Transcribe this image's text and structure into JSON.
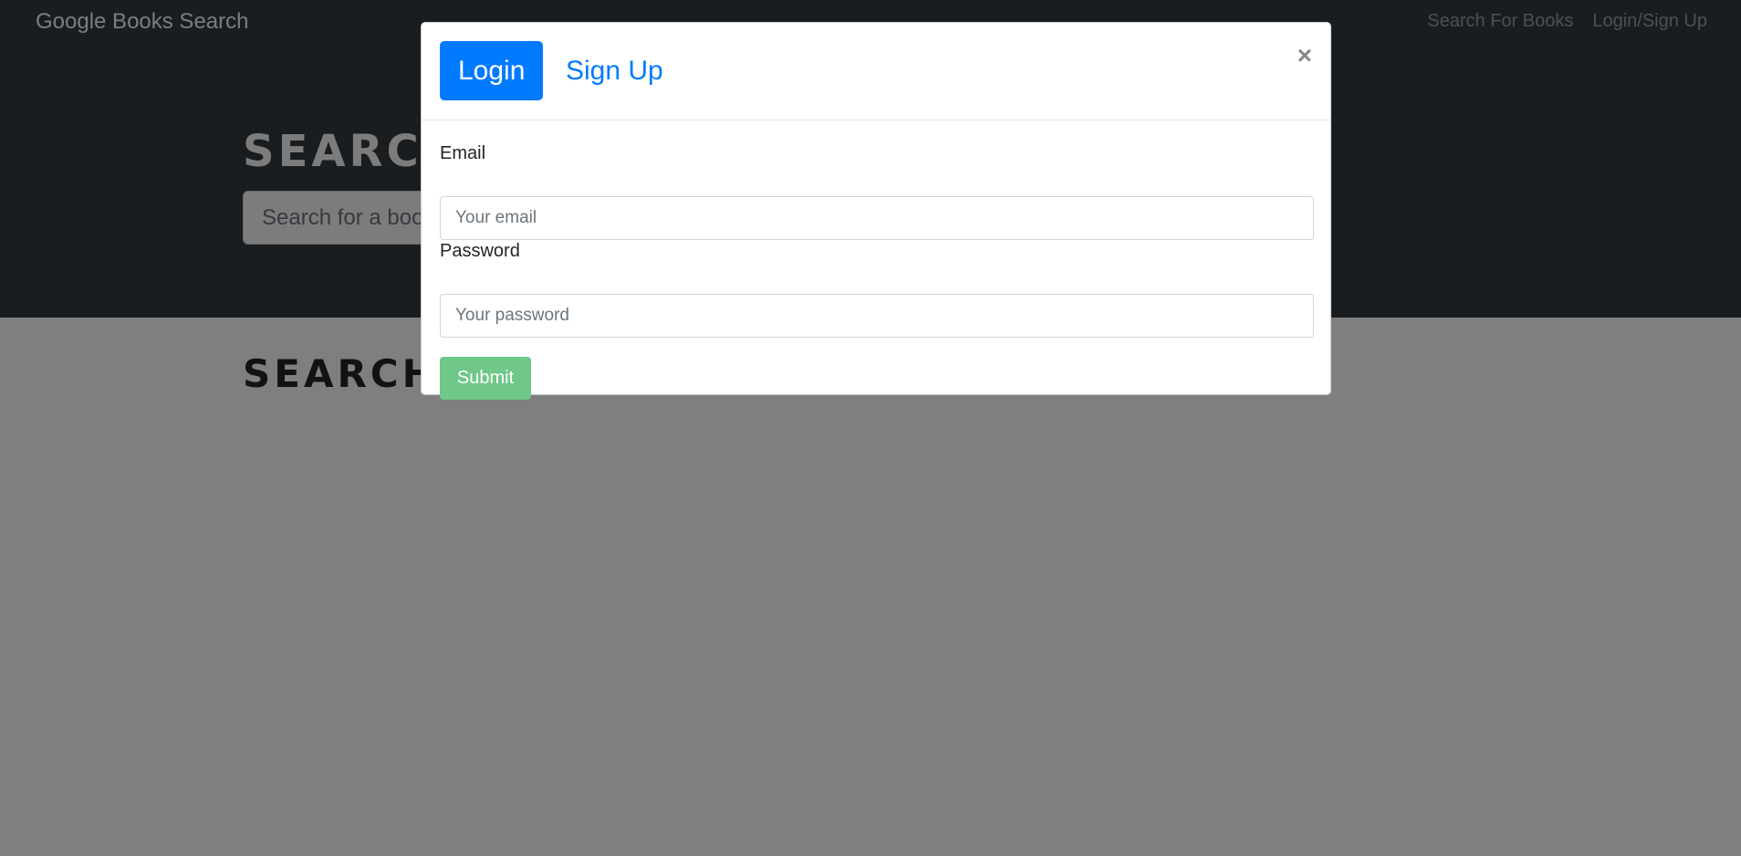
{
  "navbar": {
    "brand": "Google Books Search",
    "links": [
      "Search For Books",
      "Login/Sign Up"
    ]
  },
  "hero": {
    "title": "SEARCH FOR BOOKS!",
    "search_placeholder": "Search for a book"
  },
  "results": {
    "heading": "SEARCH FOR A BOOK TO BEGIN"
  },
  "modal": {
    "tabs": [
      "Login",
      "Sign Up"
    ],
    "active_tab": "Login",
    "close_symbol": "×",
    "email_label": "Email",
    "email_placeholder": "Your email",
    "password_label": "Password",
    "password_placeholder": "Your password",
    "submit_label": "Submit"
  },
  "colors": {
    "navbar_bg": "#343a40",
    "primary": "#007bff",
    "submit_disabled": "#6fc788",
    "backdrop": "rgba(0,0,0,0.5)"
  }
}
